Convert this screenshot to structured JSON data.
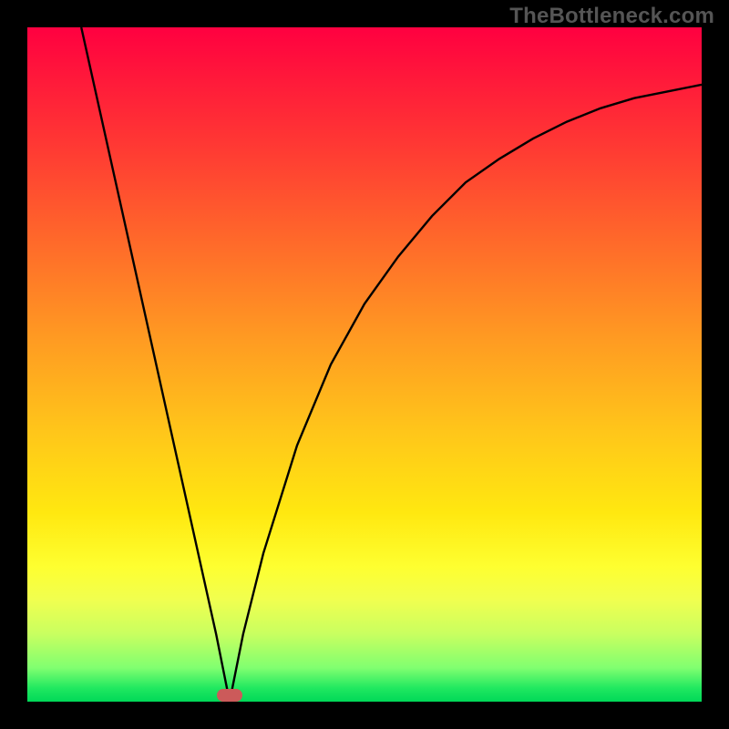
{
  "watermark": "TheBottleneck.com",
  "chart_data": {
    "type": "line",
    "title": "",
    "xlabel": "",
    "ylabel": "",
    "xlim": [
      0,
      100
    ],
    "ylim": [
      0,
      100
    ],
    "grid": false,
    "series": [
      {
        "name": "curve",
        "x": [
          8,
          10,
          12,
          14,
          16,
          18,
          20,
          22,
          24,
          26,
          28,
          30,
          32,
          35,
          40,
          45,
          50,
          55,
          60,
          65,
          70,
          75,
          80,
          85,
          90,
          95,
          100
        ],
        "values": [
          100,
          91,
          82,
          73,
          64,
          55,
          46,
          37,
          28,
          19,
          10,
          0,
          10,
          22,
          38,
          50,
          59,
          66,
          72,
          77,
          80.5,
          83.5,
          86,
          88,
          89.5,
          90.5,
          91.5
        ]
      }
    ],
    "marker": {
      "x": 30,
      "y": 1,
      "color": "#cc5a5a"
    },
    "gradient_stops": [
      {
        "pos": 0,
        "color": "#ff0040"
      },
      {
        "pos": 50,
        "color": "#ffb020"
      },
      {
        "pos": 80,
        "color": "#feff30"
      },
      {
        "pos": 100,
        "color": "#00d858"
      }
    ]
  }
}
